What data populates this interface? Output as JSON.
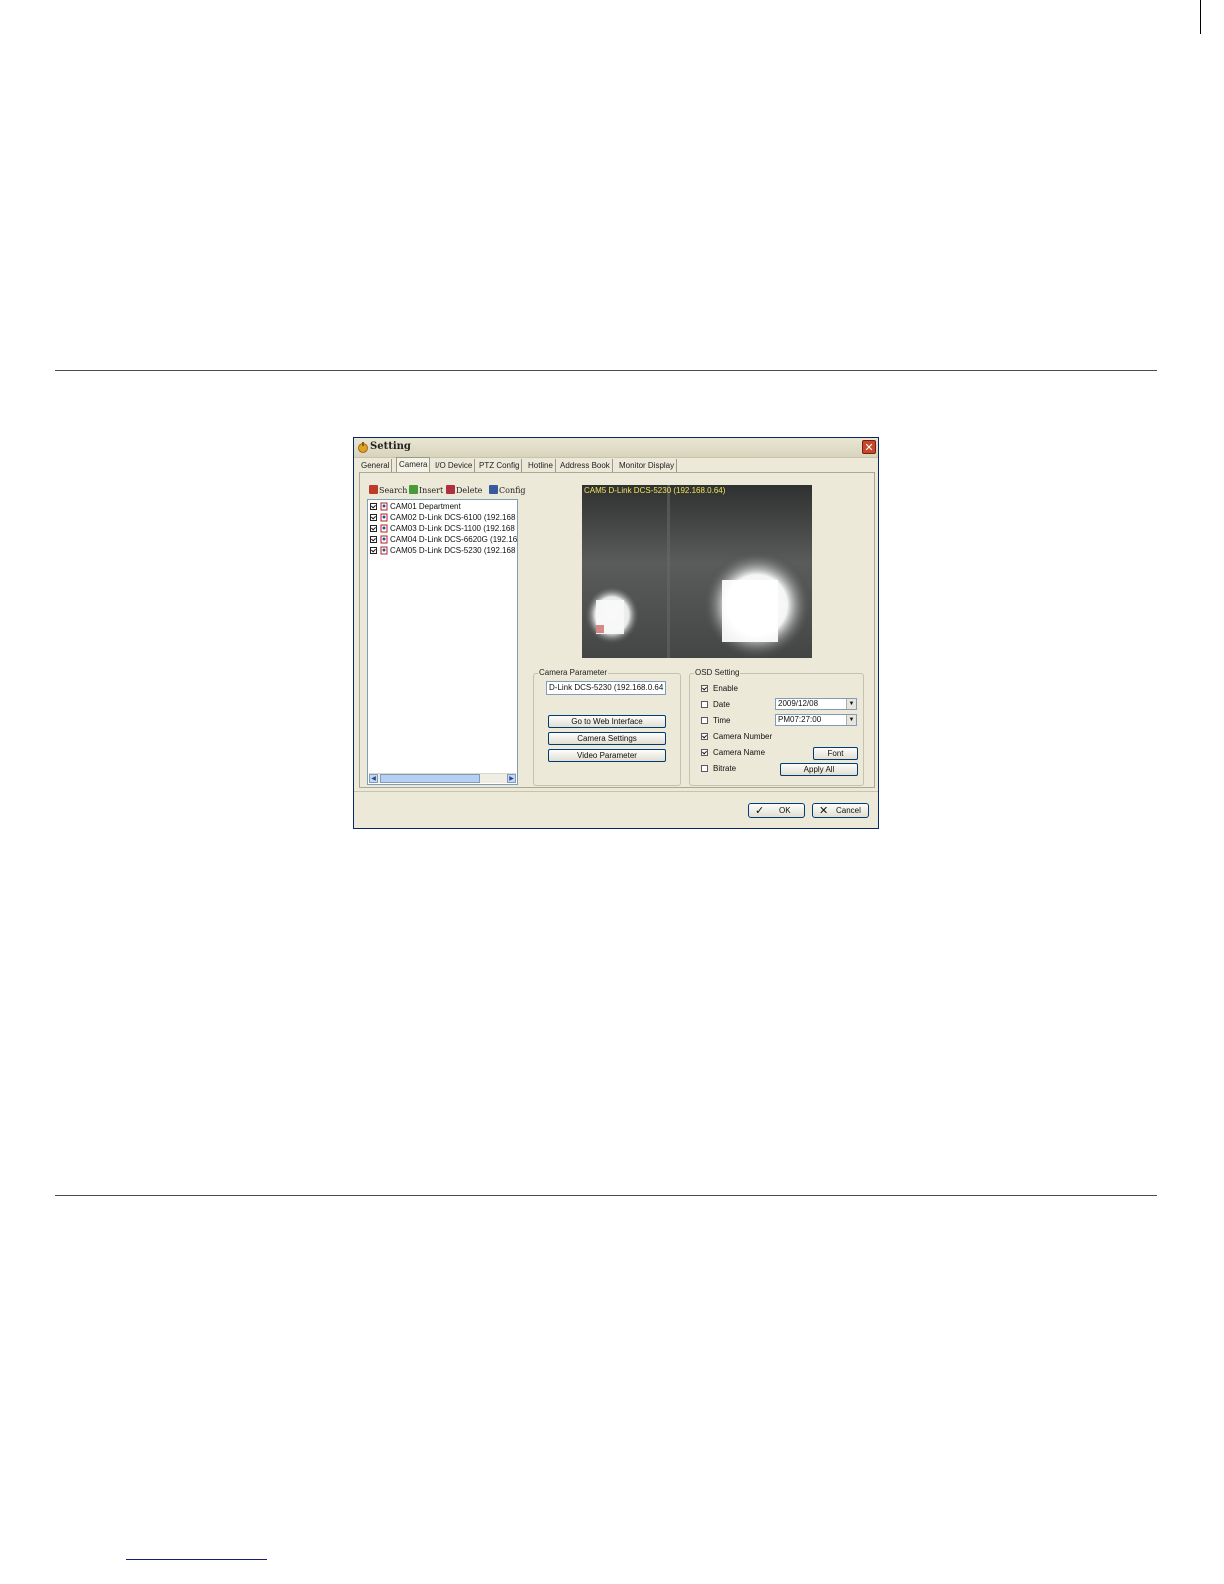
{
  "window": {
    "title": "Setting",
    "close_glyph": "✕"
  },
  "tabs": [
    "General",
    "Camera",
    "I/O Device",
    "PTZ Config",
    "Hotline",
    "Address Book",
    "Monitor Display"
  ],
  "active_tab": "Camera",
  "toolbar": {
    "search": "Search",
    "insert": "Insert",
    "delete": "Delete",
    "config": "Config"
  },
  "camera_list": [
    "CAM01 Department",
    "CAM02 D-Link DCS-6100 (192.168",
    "CAM03 D-Link DCS-1100 (192.168",
    "CAM04 D-Link DCS-6620G (192.16",
    "CAM05 D-Link DCS-5230 (192.168"
  ],
  "preview": {
    "label": "CAM5 D-Link DCS-5230 (192.168.0.64)"
  },
  "camera_parameter": {
    "label": "Camera Parameter",
    "name_value": "D-Link DCS-5230 (192.168.0.64",
    "web_button": "Go to Web Interface",
    "settings_button": "Camera Settings",
    "video_button": "Video Parameter"
  },
  "osd": {
    "label": "OSD Setting",
    "enable": {
      "label": "Enable",
      "checked": true
    },
    "date": {
      "label": "Date",
      "checked": false,
      "value": "2009/12/08"
    },
    "time": {
      "label": "Time",
      "checked": false,
      "value": "PM07:27:00"
    },
    "camera_number": {
      "label": "Camera Number",
      "checked": true
    },
    "camera_name": {
      "label": "Camera Name",
      "checked": true
    },
    "bitrate": {
      "label": "Bitrate",
      "checked": false
    },
    "font_button": "Font",
    "apply_all_button": "Apply All"
  },
  "footer": {
    "ok": "OK",
    "cancel": "Cancel"
  },
  "colors": {
    "titlebar_border": "#0a246a",
    "dialog_bg": "#ece9d8",
    "close_red": "#c8462a",
    "preview_text": "#f2e55a"
  }
}
